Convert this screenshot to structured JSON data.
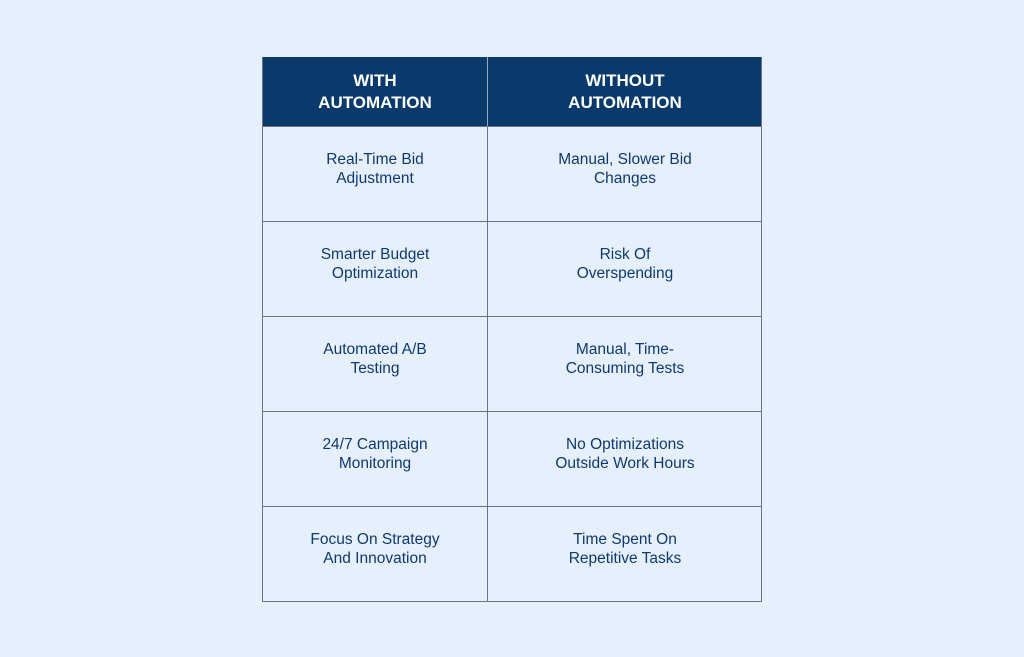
{
  "table": {
    "headers": [
      "WITH\nAUTOMATION",
      "WITHOUT\nAUTOMATION"
    ],
    "rows": [
      [
        "Real-Time Bid\nAdjustment",
        "Manual, Slower Bid\nChanges"
      ],
      [
        "Smarter Budget\nOptimization",
        "Risk Of\nOverspending"
      ],
      [
        "Automated A/B\nTesting",
        "Manual, Time-\nConsuming Tests"
      ],
      [
        "24/7 Campaign\nMonitoring",
        "No Optimizations\nOutside Work Hours"
      ],
      [
        "Focus On Strategy\nAnd Innovation",
        "Time Spent On\nRepetitive Tasks"
      ]
    ]
  },
  "colors": {
    "background": "#e6effd",
    "header": "#0a3a6b",
    "text": "#0e3a6e"
  }
}
